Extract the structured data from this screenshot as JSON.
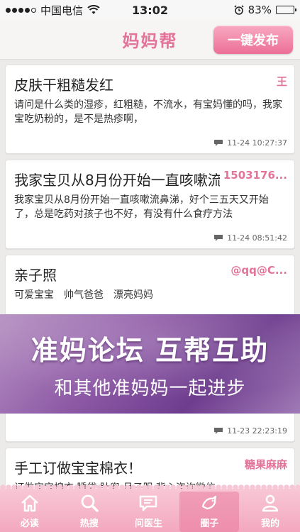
{
  "status": {
    "carrier": "中国电信",
    "time": "13:02",
    "battery": "83%",
    "battery_level": 0.83
  },
  "nav": {
    "title": "妈妈帮",
    "publish_label": "一键发布"
  },
  "posts": [
    {
      "title": "皮肤干粗糙发红",
      "author": "王",
      "body": "请问是什么类的湿疹，红粗糙，不流水，有宝妈懂的吗，我家宝吃奶粉的，是不是热疹啊，",
      "time": "11-24 10:27:37"
    },
    {
      "title": "我家宝贝从8月份开始一直咳嗽流鼻涕",
      "author": "1503176...",
      "body": "我家宝贝从8月份开始一直咳嗽流鼻涕，好个三五天又开始了，总是吃药对孩子也不好，有没有什么食疗方法",
      "time": "11-24 08:51:42"
    },
    {
      "title": "亲子照",
      "author": "@qq@C...",
      "body": "可爱宝宝　帅气爸爸　漂亮妈妈",
      "time": "11-23 22:23:19"
    },
    {
      "title": "手工订做宝宝棉衣！",
      "author": "糖果麻麻",
      "body": "订做宝宝棉衣 睡袋 肚兜 月子服 背心咨询微信",
      "time": ""
    }
  ],
  "banner": {
    "title": "准妈论坛 互帮互助",
    "subtitle": "和其他准妈妈一起进步"
  },
  "tabs": [
    {
      "label": "必读",
      "icon": "home-icon"
    },
    {
      "label": "热搜",
      "icon": "search-icon"
    },
    {
      "label": "问医生",
      "icon": "chat-bubble-icon"
    },
    {
      "label": "圈子",
      "icon": "bird-icon"
    },
    {
      "label": "我的",
      "icon": "person-icon"
    }
  ],
  "colors": {
    "accent": "#e4739a",
    "tabbar": "#f3a8bf",
    "banner": "#8e5aa6"
  }
}
